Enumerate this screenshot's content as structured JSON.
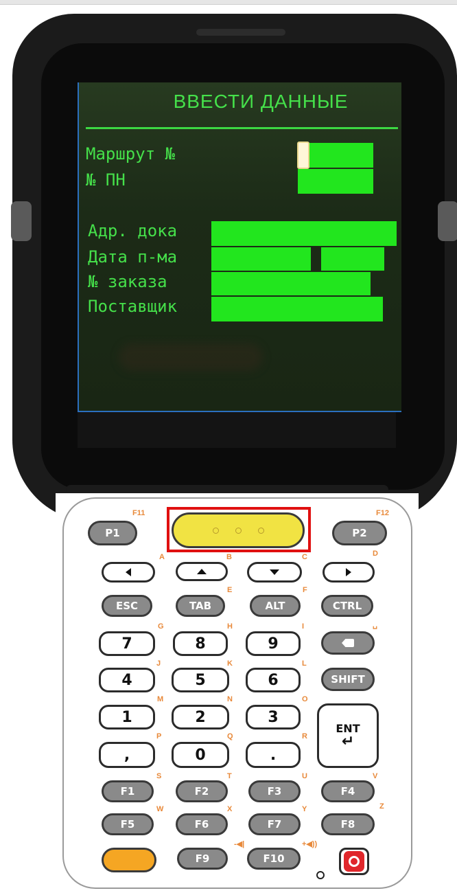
{
  "screen": {
    "title": "ВВЕСТИ ДАННЫЕ",
    "labels": {
      "route": "Маршрут №",
      "pn": "№ ПН",
      "dock": "Адр. дока",
      "date": "Дата п-ма",
      "order": "№ заказа",
      "supplier": "Поставщик"
    },
    "field_color": "#22e61e",
    "text_color": "#45e04a"
  },
  "keypad": {
    "p1": "P1",
    "p2": "P2",
    "esc": "ESC",
    "tab": "TAB",
    "alt": "ALT",
    "ctrl": "CTRL",
    "shift": "SHIFT",
    "ent": "ENT",
    "digits": {
      "k7": "7",
      "k8": "8",
      "k9": "9",
      "k4": "4",
      "k5": "5",
      "k6": "6",
      "k1": "1",
      "k2": "2",
      "k3": "3",
      "k0": "0",
      "comma": ",",
      "dot": "."
    },
    "fkeys": {
      "f1": "F1",
      "f2": "F2",
      "f3": "F3",
      "f4": "F4",
      "f5": "F5",
      "f6": "F6",
      "f7": "F7",
      "f8": "F8",
      "f9": "F9",
      "f10": "F10"
    },
    "alt_labels": {
      "f11": "F11",
      "f12": "F12",
      "a": "A",
      "b": "B",
      "c": "C",
      "d": "D",
      "e": "E",
      "f": "F",
      "g": "G",
      "h": "H",
      "i": "I",
      "j": "J",
      "k": "K",
      "l": "L",
      "m": "M",
      "n": "N",
      "o": "O",
      "p": "P",
      "q": "Q",
      "r": "R",
      "s": "S",
      "t": "T",
      "u": "U",
      "v": "V",
      "w": "W",
      "x": "X",
      "y": "Y",
      "z": "Z",
      "space": "␣",
      "vol_down": "-◀|",
      "vol_up": "+◀))"
    },
    "highlight_color": "#e01010",
    "scan_color": "#f1e343",
    "orange_color": "#f5a623"
  }
}
